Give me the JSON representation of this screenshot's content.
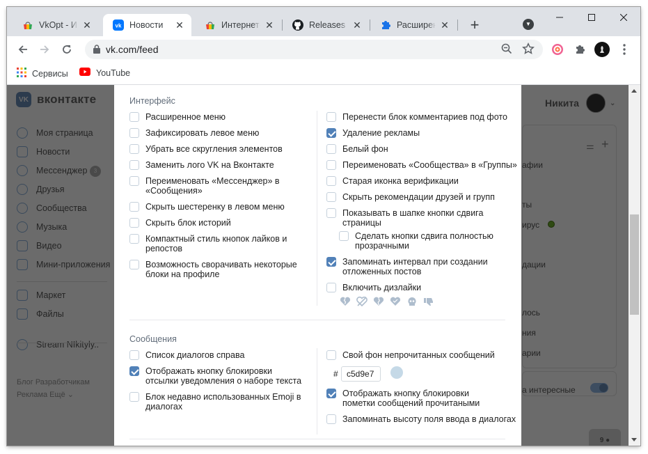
{
  "browser": {
    "tabs": [
      {
        "title": "VkOpt - Ин",
        "active": false
      },
      {
        "title": "Новости",
        "active": true
      },
      {
        "title": "Интернет-м",
        "active": false
      },
      {
        "title": "Releases · V",
        "active": false
      },
      {
        "title": "Расширени",
        "active": false
      }
    ],
    "url": "vk.com/feed",
    "bookmarks": [
      {
        "label": "Сервисы",
        "icon": "apps-grid-icon"
      },
      {
        "label": "YouTube",
        "icon": "youtube-icon"
      }
    ]
  },
  "vk": {
    "brand": "вконтакте",
    "user_name": "Никита",
    "sidebar": [
      {
        "label": "Моя страница",
        "icon": "user-icon"
      },
      {
        "label": "Новости",
        "icon": "news-icon"
      },
      {
        "label": "Мессенджер",
        "icon": "messenger-icon"
      },
      {
        "label": "Друзья",
        "icon": "friends-icon"
      },
      {
        "label": "Сообщества",
        "icon": "groups-icon"
      },
      {
        "label": "Музыка",
        "icon": "music-icon"
      },
      {
        "label": "Видео",
        "icon": "video-icon"
      },
      {
        "label": "Мини-приложения",
        "icon": "apps-icon"
      },
      {
        "label": "Маркет",
        "icon": "market-icon"
      },
      {
        "label": "Файлы",
        "icon": "files-icon"
      },
      {
        "label": "Stream NIkityly..",
        "icon": "groups-icon"
      }
    ],
    "messenger_badge": "3",
    "footer_line1": "Блог   Разработчикам",
    "footer_line2": "Реклама   Ещё ⌄",
    "right_panel": [
      "афии",
      "ты",
      "ирус",
      "дации",
      "лось",
      "ния",
      "арии"
    ],
    "right_toggle_label": "а интересные",
    "chat_count": "9"
  },
  "settings": {
    "interface_title": "Интерфейс",
    "interface_left": [
      {
        "label": "Расширенное меню",
        "checked": false
      },
      {
        "label": "Зафиксировать левое меню",
        "checked": false
      },
      {
        "label": "Убрать все скругления элементов",
        "checked": false
      },
      {
        "label": "Заменить лого VK на Вконтакте",
        "checked": false
      },
      {
        "label": "Переименовать «Мессенджер» в «Сообщения»",
        "checked": false
      },
      {
        "label": "Скрыть шестеренку в левом меню",
        "checked": false
      },
      {
        "label": "Скрыть блок историй",
        "checked": false
      },
      {
        "label": "Компактный стиль кнопок лайков и репостов",
        "checked": false
      },
      {
        "label": "Возможность сворачивать некоторые блоки на профиле",
        "checked": false
      }
    ],
    "interface_right": [
      {
        "label": "Перенести блок комментариев под фото",
        "checked": false
      },
      {
        "label": "Удаление рекламы",
        "checked": true
      },
      {
        "label": "Белый фон",
        "checked": false
      },
      {
        "label": "Переименовать «Сообщества» в «Группы»",
        "checked": false
      },
      {
        "label": "Старая иконка верификации",
        "checked": false
      },
      {
        "label": "Скрыть рекомендации друзей и групп",
        "checked": false
      },
      {
        "label": "Показывать в шапке кнопки сдвига страницы",
        "checked": false
      },
      {
        "label": "Сделать кнопки сдвига полностью прозрачными",
        "checked": false
      },
      {
        "label": "Запоминать интервал при создании отложенных постов",
        "checked": true
      },
      {
        "label": "Включить дизлайки",
        "checked": false
      }
    ],
    "dislike_icons": [
      "broken-heart-icon",
      "crossed-heart-icon",
      "broken-heart-icon",
      "heart-icon",
      "skull-icon",
      "thumbs-down-icon"
    ],
    "messages_title": "Сообщения",
    "messages_left": [
      {
        "label": "Список диалогов справа",
        "checked": false
      },
      {
        "label": "Отображать кнопку блокировки отсылки уведомления о наборе текста",
        "checked": true
      },
      {
        "label": "Блок недавно использованных Emoji в диалогах",
        "checked": false
      }
    ],
    "messages_right": [
      {
        "label": "Свой фон непрочитанных сообщений",
        "checked": false
      },
      {
        "label": "Отображать кнопку блокировки пометки сообщений прочитаными",
        "checked": true
      },
      {
        "label": "Запоминать высоту поля ввода в диалогах",
        "checked": false
      }
    ],
    "unread_bg_hash": "#",
    "unread_bg_color": "c5d9e7",
    "colors": {
      "accent": "#5181b8",
      "swatch": "#c5d9e7"
    }
  }
}
